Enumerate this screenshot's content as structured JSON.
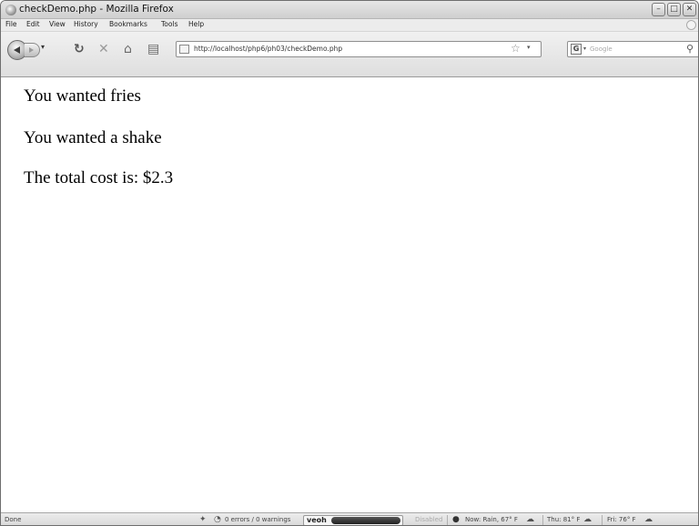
{
  "window": {
    "title": "checkDemo.php - Mozilla Firefox"
  },
  "menu": [
    "File",
    "Edit",
    "View",
    "History",
    "Bookmarks",
    "Tools",
    "Help"
  ],
  "nav": {
    "url": "http://localhost/php6/ph03/checkDemo.php",
    "search_placeholder": "Google"
  },
  "page": {
    "lines": [
      "You wanted fries",
      "You wanted a shake",
      "The total cost is: $2.3"
    ]
  },
  "status": {
    "left": "Done",
    "errors": "0 errors / 0 warnings",
    "veoh": "veoh",
    "disabled": "Disabled",
    "weather_now": "Now: Rain, 67° F",
    "weather_thu": "Thu: 81° F",
    "weather_fri": "Fri: 76° F"
  },
  "icons": {
    "back": "back-arrow-icon",
    "forward": "forward-arrow-icon",
    "reload": "reload-icon",
    "stop": "stop-icon",
    "home": "home-icon",
    "bookmark": "star-icon",
    "search": "magnifier-icon"
  }
}
